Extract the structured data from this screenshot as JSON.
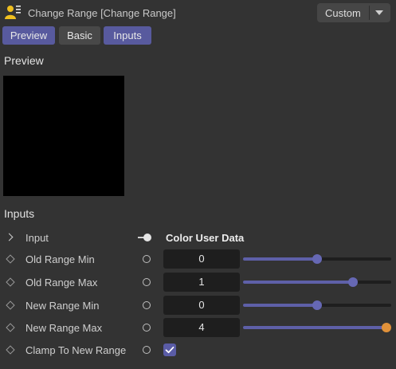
{
  "header": {
    "title": "Change Range [Change Range]",
    "preset": "Custom"
  },
  "tabs": [
    {
      "label": "Preview",
      "active": true
    },
    {
      "label": "Basic",
      "active": false
    },
    {
      "label": "Inputs",
      "active": true
    }
  ],
  "preview_section": {
    "title": "Preview"
  },
  "inputs_section": {
    "title": "Inputs",
    "input": {
      "label": "Input",
      "value": "Color User Data"
    },
    "old_range_min": {
      "label": "Old Range Min",
      "value": "0",
      "slider_fraction": 0.5
    },
    "old_range_max": {
      "label": "Old Range Max",
      "value": "1",
      "slider_fraction": 0.74
    },
    "new_range_min": {
      "label": "New Range Min",
      "value": "0",
      "slider_fraction": 0.5
    },
    "new_range_max": {
      "label": "New Range Max",
      "value": "4",
      "slider_fraction": 1.0
    },
    "clamp": {
      "label": "Clamp To New Range",
      "checked": true
    }
  },
  "colors": {
    "accent": "#585a9e",
    "slider_knob": "#6668b4",
    "slider_knob_max": "#e0913a",
    "object_icon": "#f0c020"
  },
  "icons": {
    "object": "object-user-data-icon",
    "dropdown": "chevron-down-icon",
    "expand": "chevron-right-icon",
    "keyframe": "diamond-keyframe-icon",
    "port": "port-circle-icon",
    "check": "checkmark-icon"
  }
}
